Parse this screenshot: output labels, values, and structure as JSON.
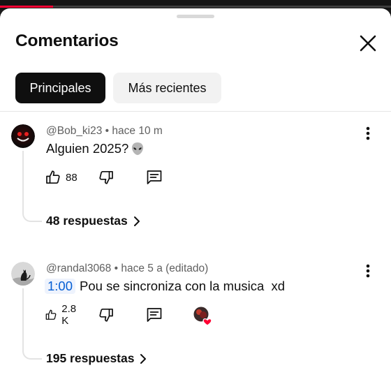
{
  "header": {
    "title": "Comentarios"
  },
  "sort_chips": [
    {
      "label": "Principales",
      "active": true
    },
    {
      "label": "Más recientes",
      "active": false
    }
  ],
  "comments": [
    {
      "author": "@Bob_ki23",
      "separator": " • ",
      "age": "hace 10 m",
      "text": "Alguien 2025?",
      "emoji_icon": "alien-icon",
      "likes": "88",
      "replies": "48 respuestas"
    },
    {
      "author": "@randal3068",
      "separator": " • ",
      "age": "hace 5 a (editado)",
      "timestamp": "1:00",
      "text": "Pou se sincroniza con la musica  xd",
      "likes": "2.8 K",
      "creator_heart": true,
      "replies": "195 respuestas"
    }
  ],
  "colors": {
    "accent_link": "#065fd4",
    "progress": "#ff0033",
    "heart": "#ff0033"
  },
  "video_progress": 0.135
}
